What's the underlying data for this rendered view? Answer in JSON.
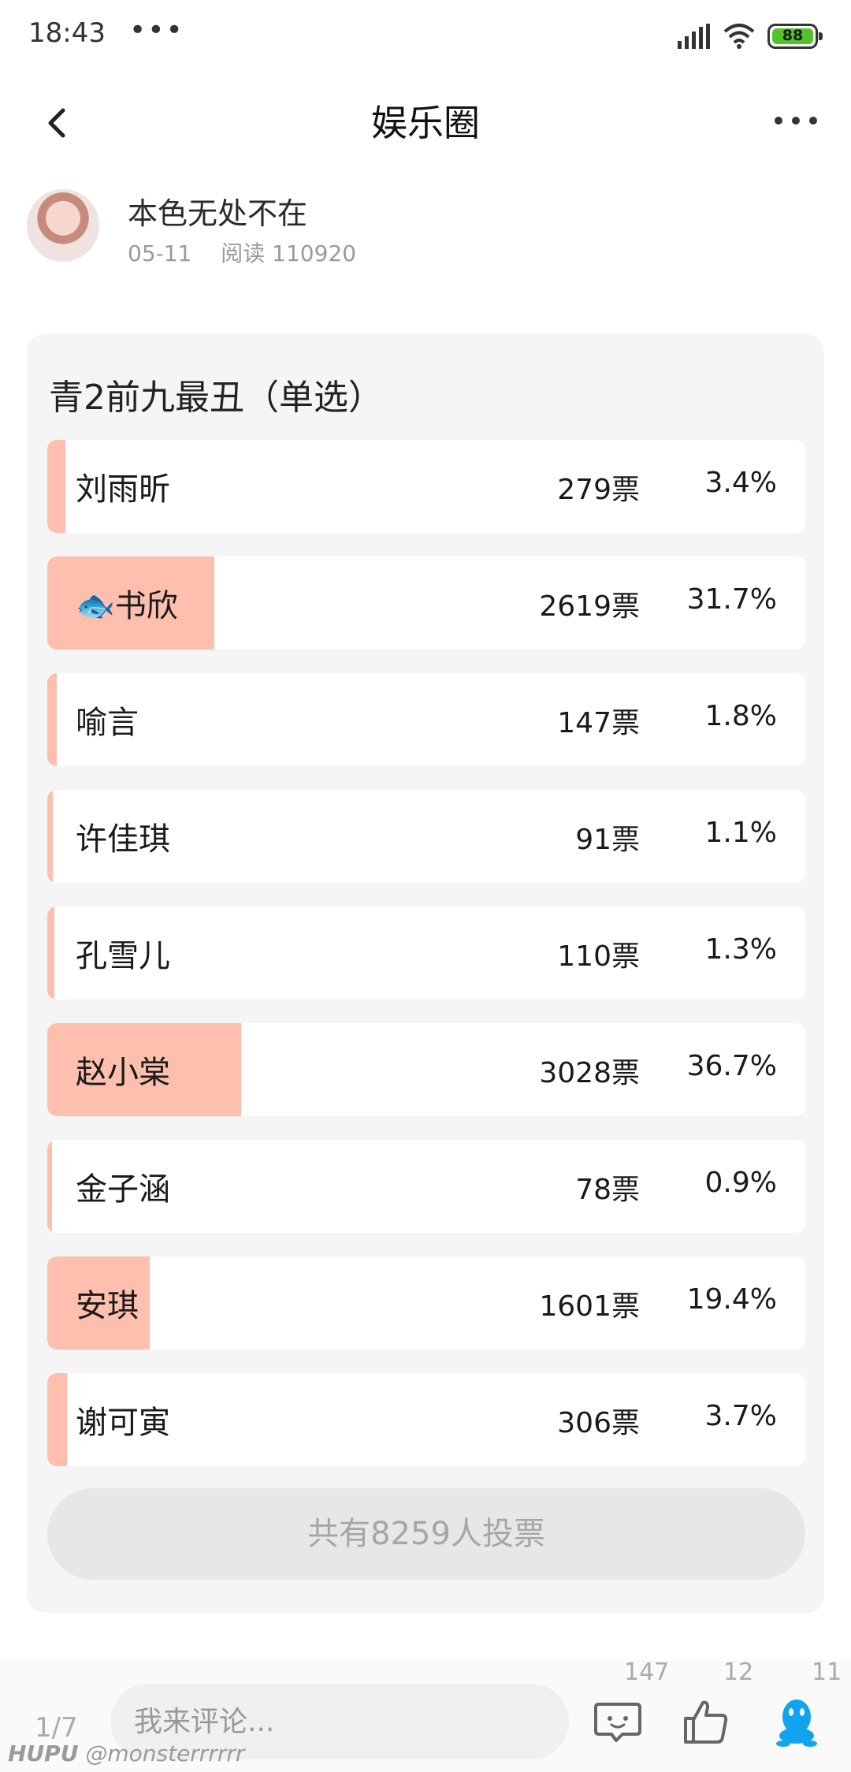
{
  "status_bar": {
    "time": "18:43",
    "dots": "•••",
    "battery": "88"
  },
  "nav": {
    "title": "娱乐圈"
  },
  "author": {
    "name": "本色无处不在",
    "date": "05-11",
    "reads": "阅读 110920"
  },
  "poll": {
    "title": "青2前九最丑（单选）",
    "options": [
      {
        "name": "刘雨昕",
        "votes": "279票",
        "percent": "3.4%",
        "share": 3.4
      },
      {
        "name": "🐟书欣",
        "votes": "2619票",
        "percent": "31.7%",
        "share": 31.7
      },
      {
        "name": "喻言",
        "votes": "147票",
        "percent": "1.8%",
        "share": 1.8
      },
      {
        "name": "许佳琪",
        "votes": "91票",
        "percent": "1.1%",
        "share": 1.1
      },
      {
        "name": "孔雪儿",
        "votes": "110票",
        "percent": "1.3%",
        "share": 1.3
      },
      {
        "name": "赵小棠",
        "votes": "3028票",
        "percent": "36.7%",
        "share": 36.7
      },
      {
        "name": "金子涵",
        "votes": "78票",
        "percent": "0.9%",
        "share": 0.9
      },
      {
        "name": "安琪",
        "votes": "1601票",
        "percent": "19.4%",
        "share": 19.4
      },
      {
        "name": "谢可寅",
        "votes": "306票",
        "percent": "3.7%",
        "share": 3.7
      }
    ],
    "total_label": "共有8259人投票",
    "bar_color": "#ffbfae"
  },
  "bottom_bar": {
    "pager": "1/7",
    "comment_placeholder": "我来评论...",
    "comment_count": "147",
    "like_count": "12",
    "share_count": "11",
    "icons": [
      "comment-icon",
      "thumbs-up-icon",
      "qq-share-icon"
    ]
  },
  "watermark": {
    "brand": "HUPU",
    "user": "@monsterrrrrr"
  }
}
